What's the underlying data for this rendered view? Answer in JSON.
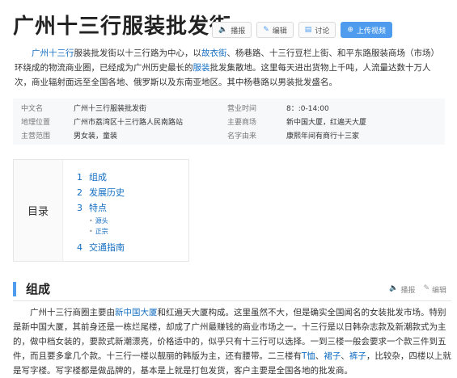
{
  "page": {
    "title": "广州十三行服装批发街"
  },
  "toolbar": [
    {
      "icon": "speaker-icon",
      "glyph": "🔈",
      "label": "播报",
      "primary": false
    },
    {
      "icon": "pencil-icon",
      "glyph": "✎",
      "label": "编辑",
      "primary": false
    },
    {
      "icon": "chat-icon",
      "glyph": "▤",
      "label": "讨论",
      "primary": false
    },
    {
      "icon": "plus-circle-icon",
      "glyph": "⊕",
      "label": "上传视频",
      "primary": true
    }
  ],
  "summary": {
    "link1": "广州十三行",
    "t1": "服装批发街以十三行路为中心，以",
    "link2": "故衣街",
    "t2": "、杨巷路、十三行豆栏上街、和平东路服装商场（市场）环绕成的物流商业圈，已经成为广州历史最长的",
    "link3": "服装",
    "t3": "批发集散地。这里每天进出货物上千吨，人流量达数十万人次，商业辐射面远至全国各地、俄罗斯以及东南亚地区。其中杨巷路以男装批发盛名。"
  },
  "infobox": {
    "rows": [
      {
        "k1": "中文名",
        "v1": "广州十三行服装批发街",
        "k2": "营业时间",
        "v2": "8：:0-14:00"
      },
      {
        "k1": "地理位置",
        "v1": "广州市荔湾区十三行路人民南路站",
        "k2": "主要商场",
        "v2": "新中国大厦，红遍天大厦"
      },
      {
        "k1": "主营范围",
        "v1": "男女装，童装",
        "k2": "名字由来",
        "v2": "康熙年间有商行十三家"
      }
    ]
  },
  "toc": {
    "title": "目录",
    "items": [
      {
        "num": "1",
        "label": "组成"
      },
      {
        "num": "2",
        "label": "发展历史"
      },
      {
        "num": "3",
        "label": "特点"
      },
      {
        "num": "4",
        "label": "交通指南"
      }
    ],
    "subitems": [
      "源头",
      "正宗"
    ]
  },
  "section": {
    "title": "组成",
    "actions": [
      {
        "icon": "speaker-icon",
        "glyph": "🔈",
        "label": "播报"
      },
      {
        "icon": "pencil-icon",
        "glyph": "✎",
        "label": "编辑"
      }
    ],
    "text": {
      "t1": "广州十三行商圈主要由",
      "link1": "新中国大厦",
      "t2": "和红遍天大厦构成。这里虽然不大，但是确实全国闻名的女装批发市场。特别是新中国大厦，其前身还是一栋烂尾楼，却成了广州最赚钱的商业市场之一。十三行是以日韩杂志款及新潮款式为主的，做中档女装的，要款式新潮漂亮，价格适中的，似乎只有十三行可以选择。一到三楼一般会要求一个款三件到五件，而且要多拿几个款。十三行一楼以靓丽的韩版为主，还有腰带。二三楼有",
      "link2": "T恤",
      "t3": "、",
      "link3": "裙子",
      "t4": "、",
      "link4": "裤子",
      "t5": "，比较杂，四楼以上就是写字楼。写字楼都是做品牌的，基本是上就是打包发货，客户主要是全国各地的批发商。"
    }
  }
}
